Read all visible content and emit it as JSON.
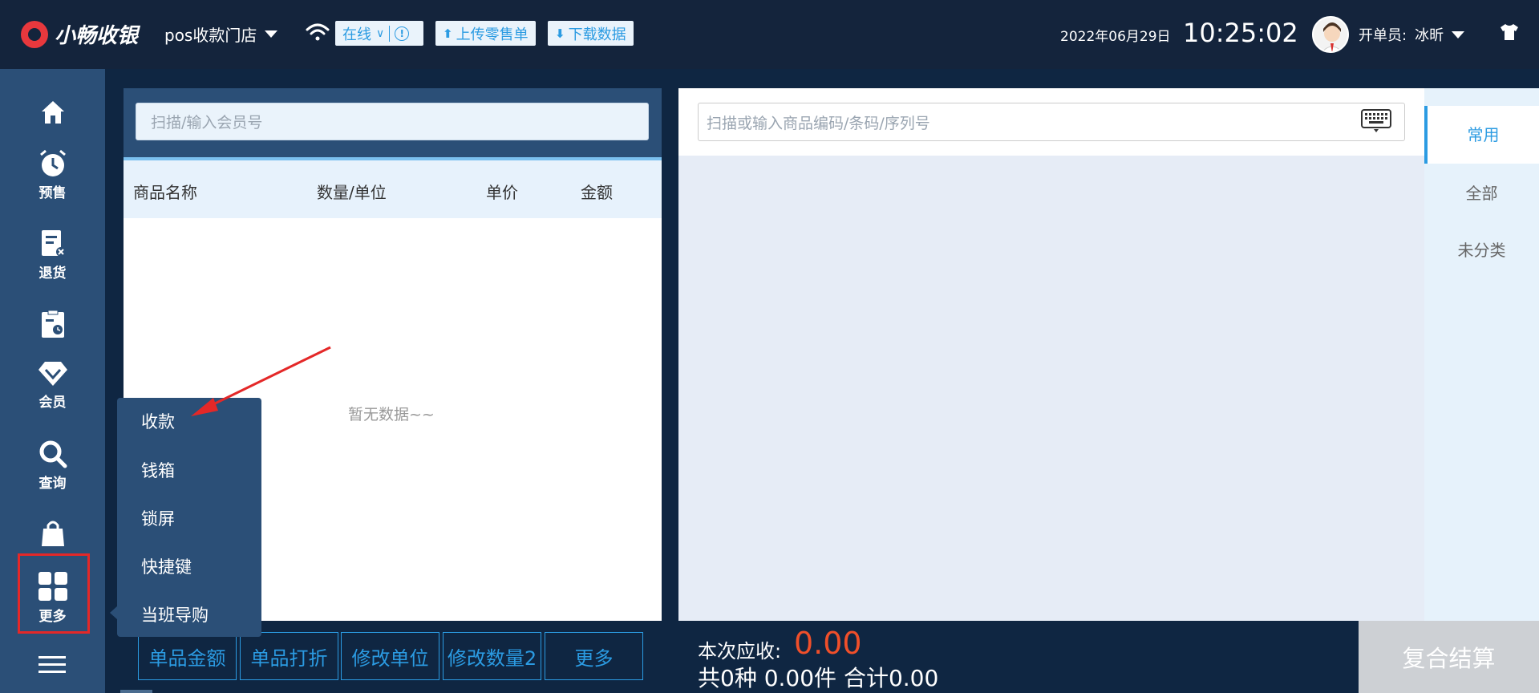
{
  "header": {
    "logo_text": "小畅收银",
    "store_name": "pos收款门店",
    "online_status": "在线",
    "upload_label": "上传零售单",
    "download_label": "下载数据",
    "date": "2022年06月29日",
    "time": "10:25:02",
    "operator_label": "开单员:",
    "operator_name": "冰昕"
  },
  "sidebar": {
    "items": [
      {
        "label": ""
      },
      {
        "label": "预售"
      },
      {
        "label": "退货"
      },
      {
        "label": ""
      },
      {
        "label": "会员"
      },
      {
        "label": "查询"
      },
      {
        "label": ""
      },
      {
        "label": "更多"
      }
    ]
  },
  "member": {
    "placeholder": "扫描/输入会员号"
  },
  "cart": {
    "columns": [
      "商品名称",
      "数量/单位",
      "单价",
      "金额"
    ],
    "empty_text": "暂无数据~~"
  },
  "goods": {
    "placeholder": "扫描或输入商品编码/条码/序列号"
  },
  "categories": [
    "常用",
    "全部",
    "未分类"
  ],
  "bottom": {
    "buttons": [
      "单品金额",
      "单品打折",
      "修改单位",
      "修改数量2",
      "更多"
    ],
    "due_label": "本次应收:",
    "due_value": "0.00",
    "summary": "共0种 0.00件 合计0.00",
    "settle_label": "复合结算"
  },
  "popup_menu": {
    "items": [
      "收款",
      "钱箱",
      "锁屏",
      "快捷键",
      "当班导购"
    ]
  },
  "colors": {
    "accent": "#2b9be2",
    "sidebar": "#2b4f77",
    "header": "#14243c",
    "due": "#f04f2a",
    "annotation": "#e42828"
  }
}
